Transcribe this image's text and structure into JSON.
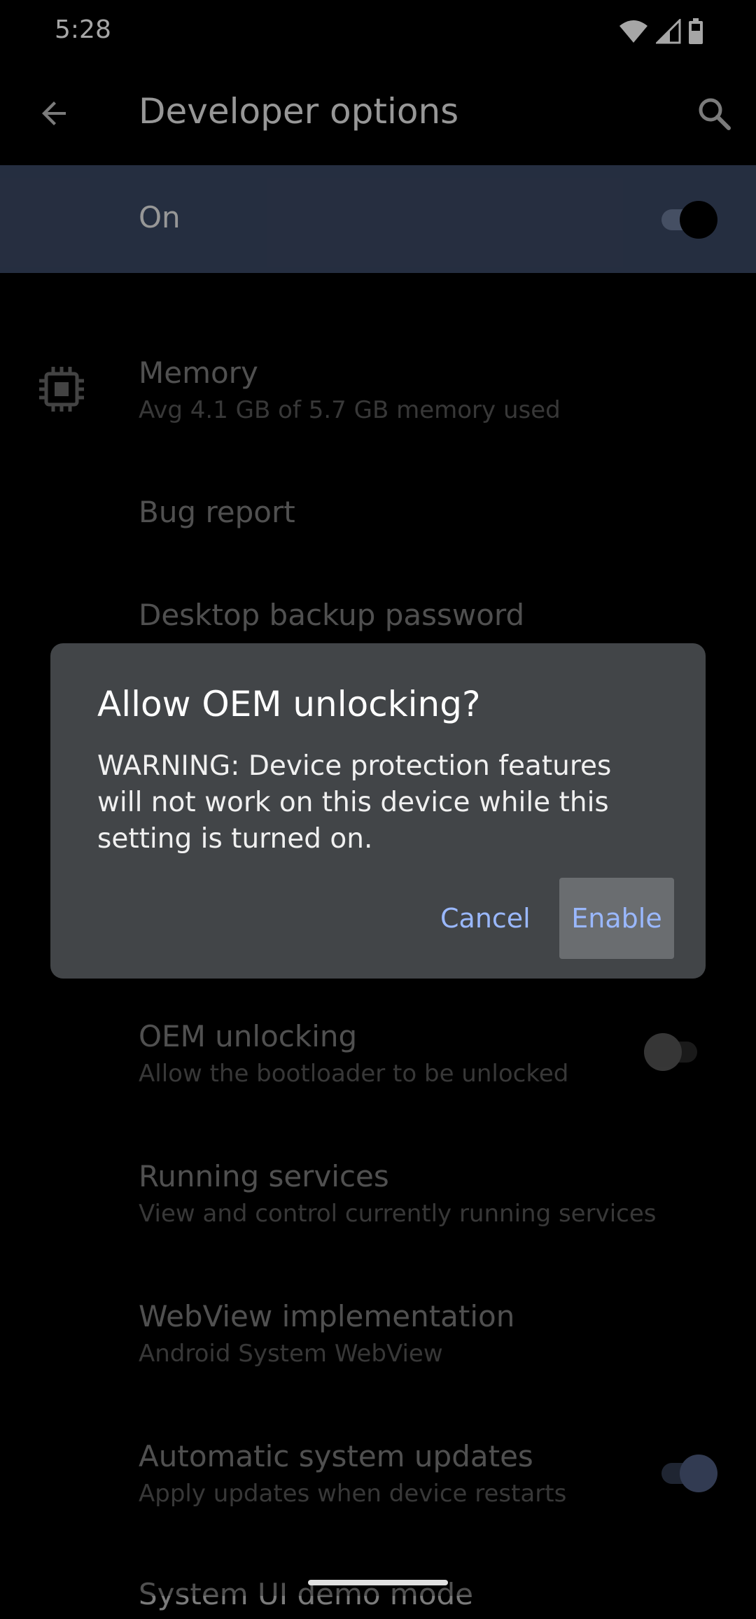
{
  "status_bar": {
    "time": "5:28",
    "icons": [
      "wifi-icon",
      "cell-signal-icon",
      "battery-icon"
    ]
  },
  "app_bar": {
    "title": "Developer options",
    "back_icon": "arrow-back-icon",
    "search_icon": "search-icon"
  },
  "master_switch": {
    "label": "On",
    "checked": true
  },
  "items": {
    "memory": {
      "title": "Memory",
      "subtitle": "Avg 4.1 GB of 5.7 GB memory used",
      "icon": "memory-chip-icon"
    },
    "bug_report": {
      "title": "Bug report"
    },
    "desktop_backup": {
      "title": "Desktop backup password"
    },
    "oem_unlocking": {
      "title": "OEM unlocking",
      "subtitle": "Allow the bootloader to be unlocked",
      "checked": false
    },
    "running_services": {
      "title": "Running services",
      "subtitle": "View and control currently running services"
    },
    "webview": {
      "title": "WebView implementation",
      "subtitle": "Android System WebView"
    },
    "auto_updates": {
      "title": "Automatic system updates",
      "subtitle": "Apply updates when device restarts",
      "checked": true
    },
    "demo_mode": {
      "title": "System UI demo mode"
    }
  },
  "dialog": {
    "title": "Allow OEM unlocking?",
    "message": "WARNING: Device protection features will not work on this device while this setting is turned on.",
    "cancel_label": "Cancel",
    "enable_label": "Enable"
  },
  "colors": {
    "background": "#000000",
    "header_highlight": "#3a4763",
    "dialog_surface": "#424548",
    "accent": "#9ab8ff"
  }
}
